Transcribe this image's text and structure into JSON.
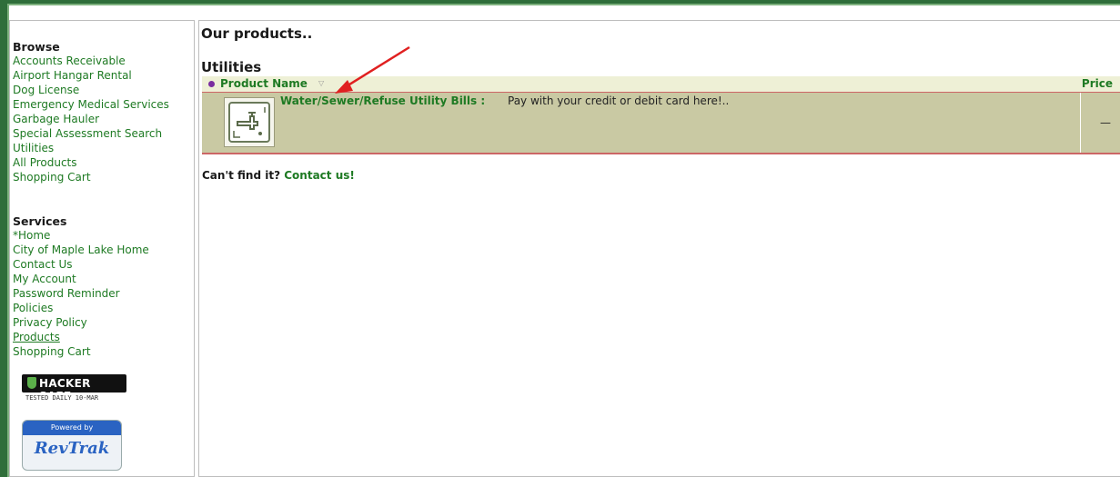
{
  "sidebar": {
    "browse_heading": "Browse",
    "browse_items": [
      "Accounts Receivable",
      "Airport Hangar Rental",
      "Dog License",
      "Emergency Medical Services",
      "Garbage Hauler",
      "Special Assessment Search",
      "Utilities",
      "All Products",
      "Shopping Cart"
    ],
    "services_heading": "Services",
    "services_items": [
      "*Home",
      "City of Maple Lake Home",
      "Contact Us",
      "My Account",
      "Password Reminder",
      "Policies",
      "Privacy Policy",
      "Products",
      "Shopping Cart"
    ],
    "hacker_safe": {
      "label": "HACKER SAFE",
      "sub": "TESTED DAILY  10-MAR"
    },
    "revtrak": {
      "powered_by": "Powered by",
      "logo": "RevTrak"
    }
  },
  "main": {
    "page_title": "Our products..",
    "section_title": "Utilities",
    "table": {
      "col_product": "Product Name",
      "col_price": "Price",
      "rows": [
        {
          "name": "Water/Sewer/Refuse Utility Bills :",
          "description": "Pay with your credit or debit card here!..",
          "price": "—",
          "icon": "faucet-icon"
        }
      ]
    },
    "cant_find_text": "Can't find it?",
    "contact_link": "Contact us!"
  },
  "colors": {
    "frame_green": "#2f6e3a",
    "link_green": "#1e7a23",
    "row_bg": "#c9c9a3",
    "header_bg": "#eef0d6",
    "divider_red": "#cc6666",
    "arrow_red": "#e02020"
  }
}
